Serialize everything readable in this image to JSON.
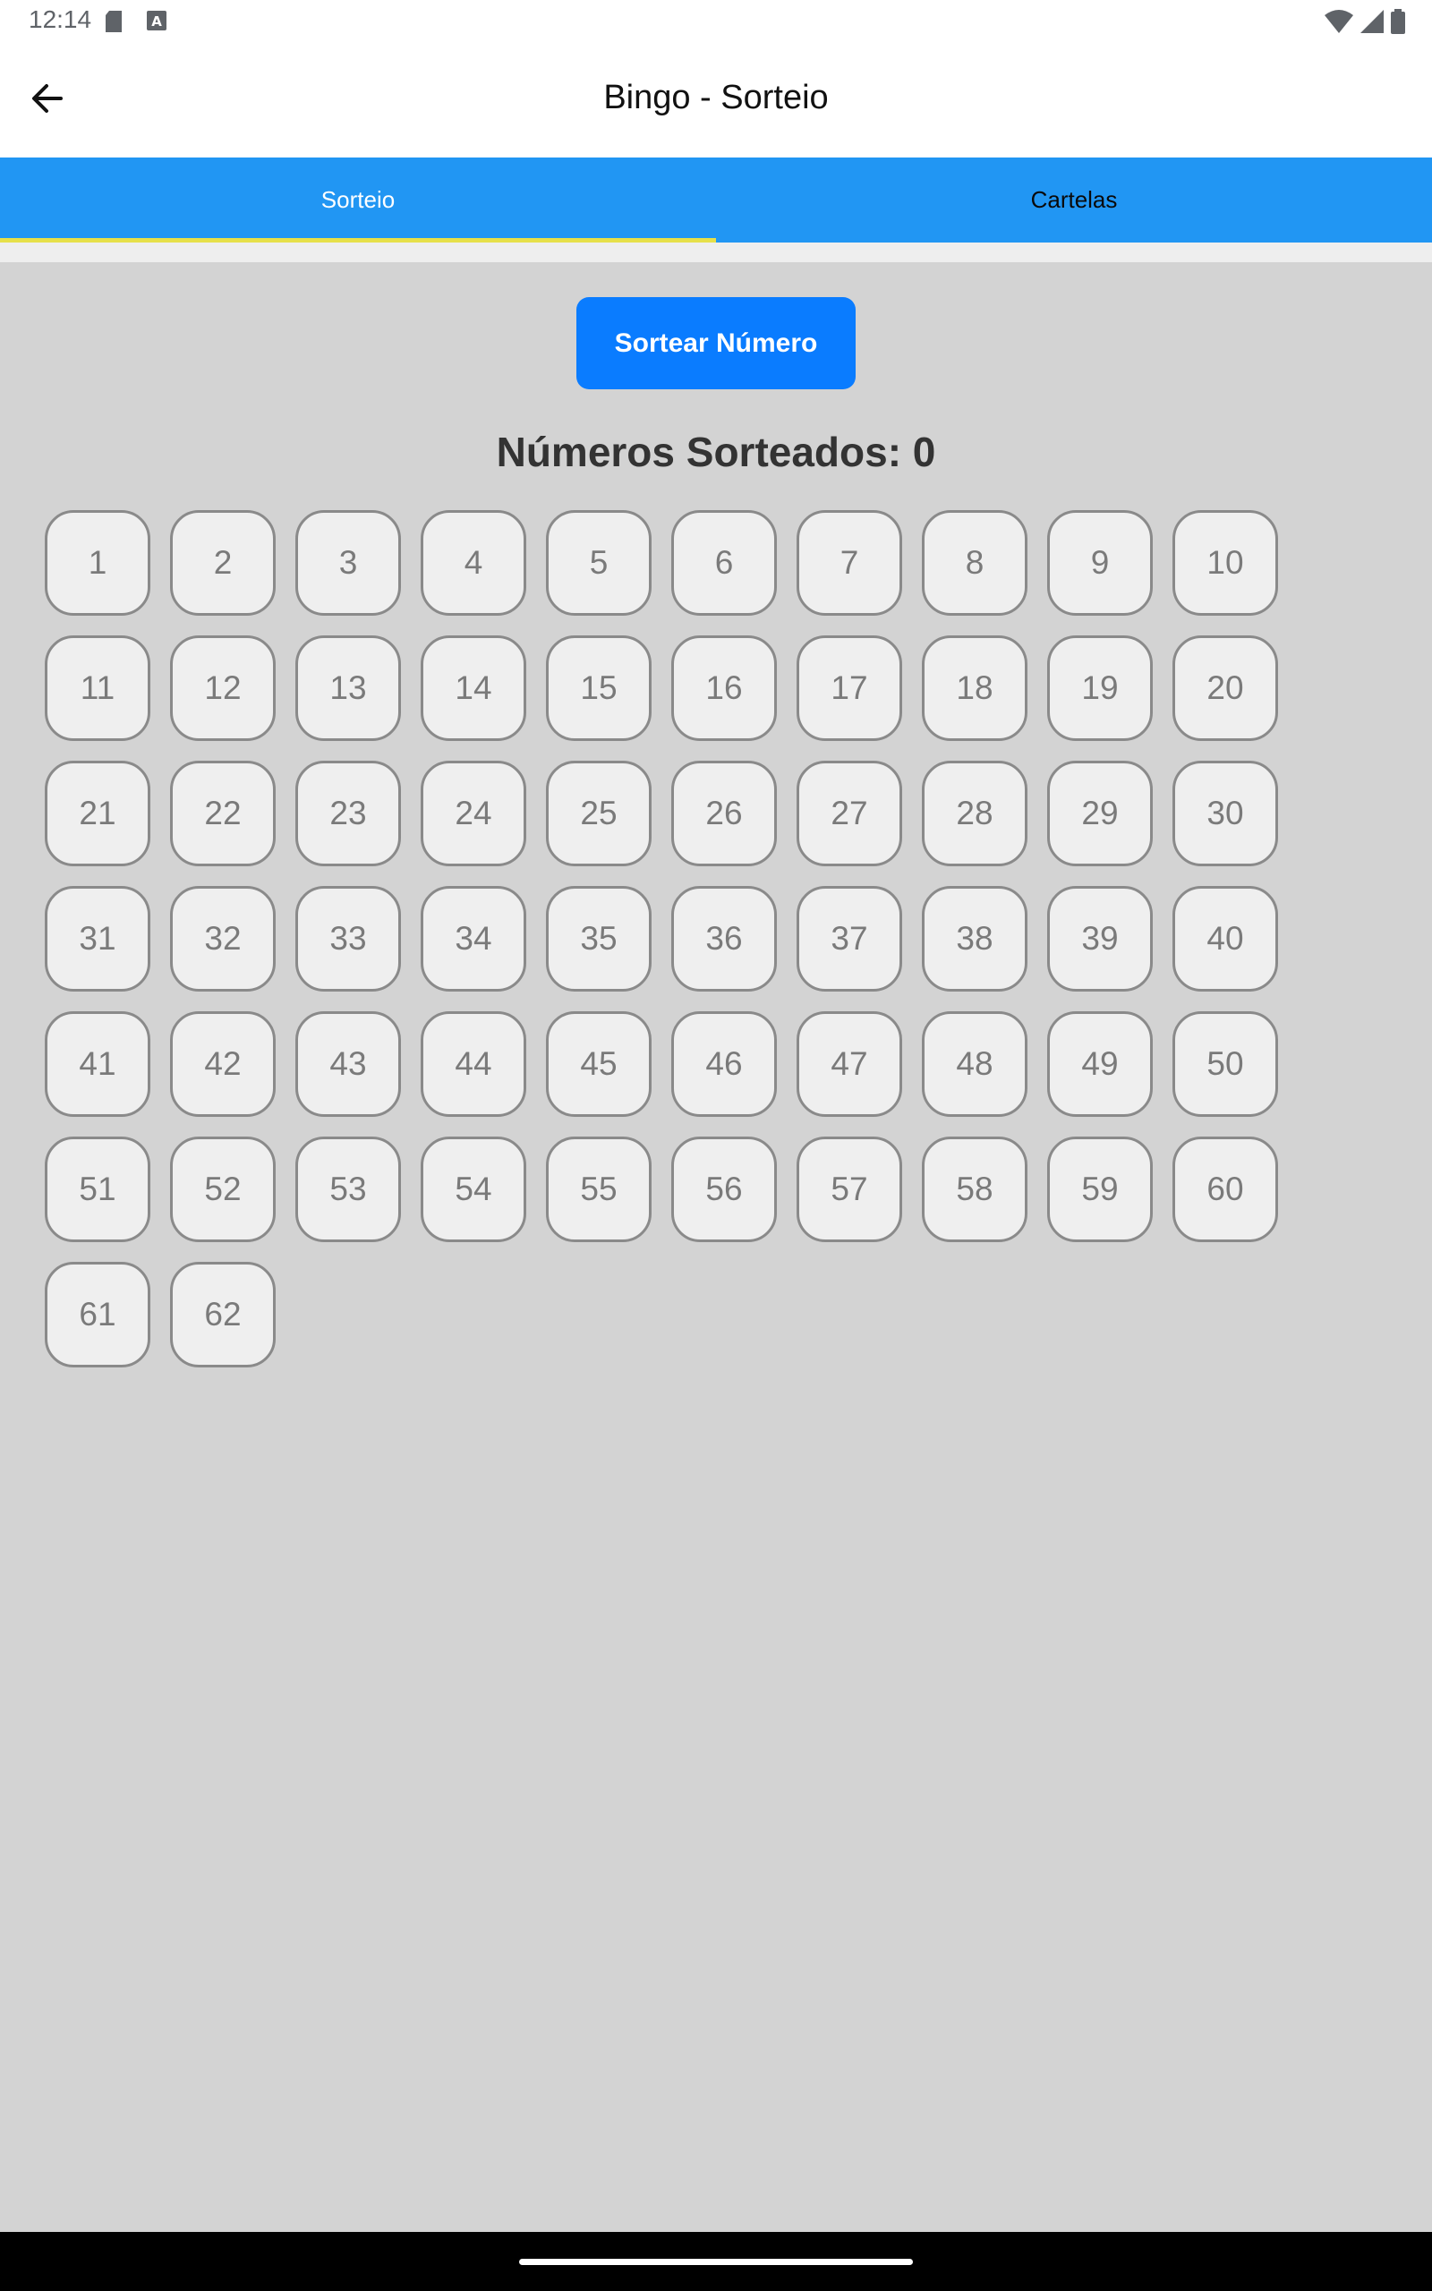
{
  "status_bar": {
    "time": "12:14",
    "left_icons": [
      "sd-card-icon",
      "a-badge-icon"
    ],
    "right_icons": [
      "wifi-icon",
      "signal-icon",
      "battery-icon"
    ]
  },
  "app_bar": {
    "title": "Bingo - Sorteio",
    "back_icon": "arrow-back-icon"
  },
  "tabs": [
    {
      "label": "Sorteio",
      "active": true
    },
    {
      "label": "Cartelas",
      "active": false
    }
  ],
  "draw_button": {
    "label": "Sortear Número"
  },
  "drawn_count_label": "Números Sorteados: 0",
  "numbers": [
    "1",
    "2",
    "3",
    "4",
    "5",
    "6",
    "7",
    "8",
    "9",
    "10",
    "11",
    "12",
    "13",
    "14",
    "15",
    "16",
    "17",
    "18",
    "19",
    "20",
    "21",
    "22",
    "23",
    "24",
    "25",
    "26",
    "27",
    "28",
    "29",
    "30",
    "31",
    "32",
    "33",
    "34",
    "35",
    "36",
    "37",
    "38",
    "39",
    "40",
    "41",
    "42",
    "43",
    "44",
    "45",
    "46",
    "47",
    "48",
    "49",
    "50",
    "51",
    "52",
    "53",
    "54",
    "55",
    "56",
    "57",
    "58",
    "59",
    "60",
    "61",
    "62"
  ],
  "colors": {
    "tab_bar": "#2196f3",
    "tab_indicator": "#e6e04a",
    "draw_button": "#0a7cff",
    "background": "#d3d3d3",
    "ball_fill": "#efefef",
    "ball_border": "#8a8a8a"
  }
}
